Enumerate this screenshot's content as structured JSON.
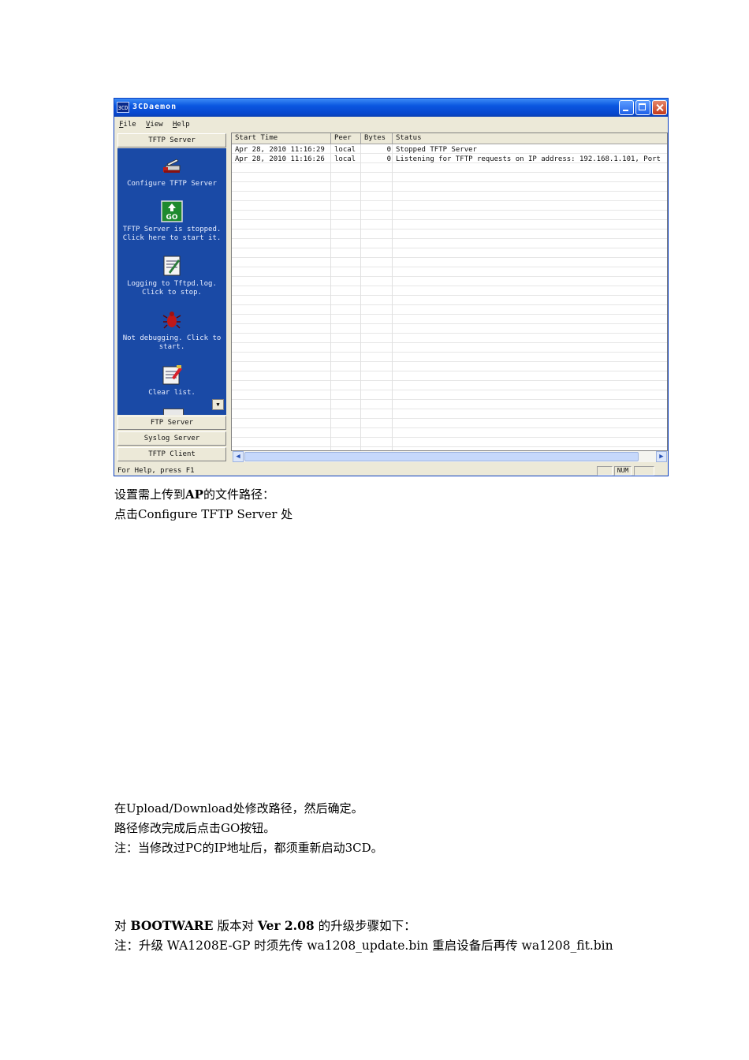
{
  "window": {
    "title": "3CDaemon",
    "app_icon_text": "3CD",
    "menu": [
      "File",
      "View",
      "Help"
    ]
  },
  "left_panel": {
    "active_tab": "TFTP Server",
    "actions": [
      {
        "icon": "wrench-knife-icon",
        "label": "Configure TFTP Server"
      },
      {
        "icon": "go-icon",
        "icon_text": "GO",
        "label": "TFTP Server is stopped. Click here to start it."
      },
      {
        "icon": "log-notepad-icon",
        "label": "Logging to Tftpd.log. Click to stop."
      },
      {
        "icon": "bug-icon",
        "label": "Not debugging. Click to start."
      },
      {
        "icon": "clear-list-icon",
        "label": "Clear list."
      }
    ],
    "other_tabs": [
      "FTP Server",
      "Syslog Server",
      "TFTP Client"
    ]
  },
  "log_table": {
    "columns": [
      "Start Time",
      "Peer",
      "Bytes",
      "Status"
    ],
    "rows": [
      {
        "start_time": "Apr 28, 2010 11:16:29",
        "peer": "local",
        "bytes": "0",
        "status": "Stopped TFTP Server"
      },
      {
        "start_time": "Apr 28, 2010 11:16:26",
        "peer": "local",
        "bytes": "0",
        "status": "Listening for TFTP requests on IP address: 192.168.1.101, Port"
      }
    ]
  },
  "status_bar": {
    "help": "For Help, press F1",
    "num": "NUM"
  },
  "document": {
    "line1_pre": "设置需上传到",
    "line1_bold": "AP",
    "line1_post": "的文件路径：",
    "line2": "点击Configure TFTP Server  处",
    "line3": "在Upload/Download处修改路径，然后确定。",
    "line4": "路径修改完成后点击GO按钮。",
    "line5": "注：当修改过PC的IP地址后，都须重新启动3CD。",
    "line6_a": "对 ",
    "line6_b": "BOOTWARE",
    "line6_c": " 版本对 ",
    "line6_d": "Ver 2.08",
    "line6_e": " 的升级步骤如下：",
    "line7": "注：升级 WA1208E-GP 时须先传 wa1208_update.bin 重启设备后再传 wa1208_fit.bin"
  },
  "colors": {
    "titlebar": "#0a56e0",
    "panel_blue": "#1a4aa6",
    "close_button": "#c33a1c"
  }
}
